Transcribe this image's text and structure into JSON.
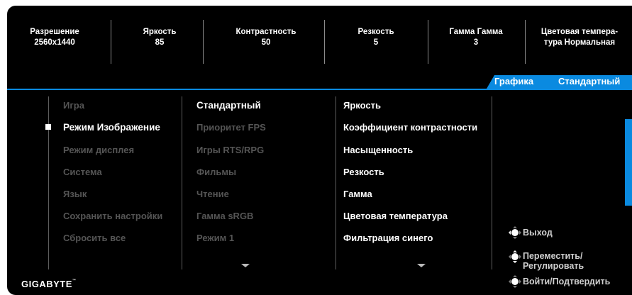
{
  "stats": [
    {
      "label": "Разрешение",
      "value": "2560x1440"
    },
    {
      "label": "Яркость",
      "value": "85"
    },
    {
      "label": "Контрастность",
      "value": "50"
    },
    {
      "label": "Резкость",
      "value": "5"
    },
    {
      "label": "Гамма Гамма",
      "value": "3"
    },
    {
      "label": "Цветовая темпера-",
      "value": "тура Нормальная"
    }
  ],
  "tabs": {
    "active": "Графика",
    "second": "Стандартный"
  },
  "menu_main": [
    "Игра",
    "Режим Изображение",
    "Режим дисплея",
    "Система",
    "Язык",
    "Сохранить настройки",
    "Сбросить все"
  ],
  "menu_modes": [
    "Стандартный",
    "Приоритет FPS",
    "Игры RTS/RPG",
    "Фильмы",
    "Чтение",
    "Гамма sRGB",
    "Режим 1"
  ],
  "menu_settings": [
    "Яркость",
    "Коэффициент контрастности",
    "Насыщенность",
    "Резкость",
    "Гамма",
    "Цветовая температура",
    "Фильтрация синего"
  ],
  "hints": {
    "exit": "Выход",
    "move_line1": "Переместить/",
    "move_line2": "Регулировать",
    "enter": "Войти/Подтвердить"
  },
  "brand": "GIGABYTE",
  "brand_tm": "™",
  "colors": {
    "accent": "#0a8ae0",
    "background": "#000000",
    "dim_text": "#555555",
    "text": "#ffffff"
  }
}
